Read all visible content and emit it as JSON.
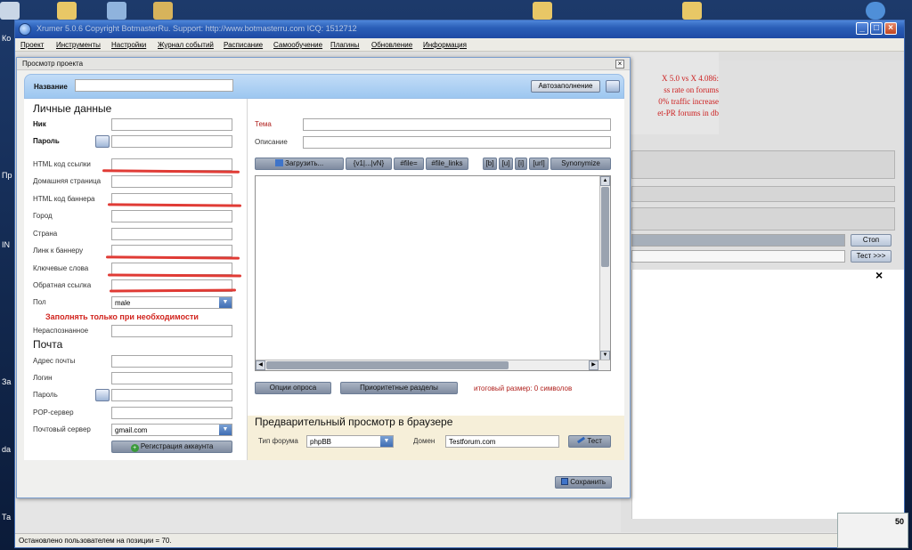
{
  "window": {
    "title": "Xrumer 5.0.6 Copyright BotmasterRu. Support: http://www.botmasterru.com ICQ: 1512712",
    "menu": [
      "Проект",
      "Инструменты",
      "Настройки",
      "Журнал событий",
      "Расписание",
      "Самообучение",
      "Плагины",
      "Обновление",
      "Информация"
    ],
    "controls": {
      "minimize": "_",
      "maximize": "□",
      "close": "×"
    }
  },
  "desktop": {
    "labels": [
      "Ко",
      "Пр",
      "IN",
      "За",
      "da",
      "Та"
    ]
  },
  "promo": [
    "X 5.0 vs X 4.086:",
    "ss rate on forums",
    "0% traffic increase",
    "et-PR forums in db"
  ],
  "right_panel": {
    "stop_button": "Стоп",
    "test_button": "Тест >>>",
    "close_glyph": "×"
  },
  "status": {
    "text": "Остановлено пользователем на позиции = 70."
  },
  "tray": {
    "value": "50"
  },
  "dialog": {
    "title": "Просмотр проекта",
    "close_glyph": "×",
    "name": {
      "label": "Название",
      "value": "",
      "autofill": "Автозаполнение"
    },
    "personal": {
      "heading": "Личные данные",
      "nick": "Ник",
      "password": "Пароль",
      "html_link": "HTML код ссылки",
      "homepage": "Домашняя страница",
      "html_banner": "HTML код баннера",
      "city": "Город",
      "country": "Страна",
      "banner_link": "Линк к баннеру",
      "keywords": "Ключевые слова",
      "backlink": "Обратная ссылка",
      "gender": "Пол",
      "gender_value": "male",
      "warning": "Заполнять только при необходимости",
      "unrecognized": "Нераспознанное"
    },
    "mail": {
      "heading": "Почта",
      "address": "Адрес почты",
      "login": "Логин",
      "password": "Пароль",
      "pop": "POP-сервер",
      "mail_server": "Почтовый сервер",
      "mail_server_value": "gmail.com",
      "register": "Регистрация аккаунта"
    },
    "message": {
      "topic": "Тема",
      "description": "Описание",
      "toolbar": [
        "Загрузить...",
        "{v1|...|vN}",
        "#file=",
        "#file_links",
        "[b]",
        "[u]",
        "[i]",
        "[url]",
        "Synonymize"
      ],
      "poll_options": "Опции опроса",
      "priority_sections": "Приоритетные разделы",
      "size_text": "итоговый размер: 0 символов"
    },
    "preview": {
      "heading": "Предварительный просмотр в браузере",
      "forum_type_label": "Тип форума",
      "forum_type_value": "phpBB",
      "domain_label": "Домен",
      "domain_value": "Testforum.com",
      "test_button": "Тест"
    },
    "save_button": "Сохранить"
  },
  "colors": {
    "accent_red": "#e03b35",
    "title_blue": "#2b5fb8",
    "band_blue": "#a9cdf2"
  }
}
